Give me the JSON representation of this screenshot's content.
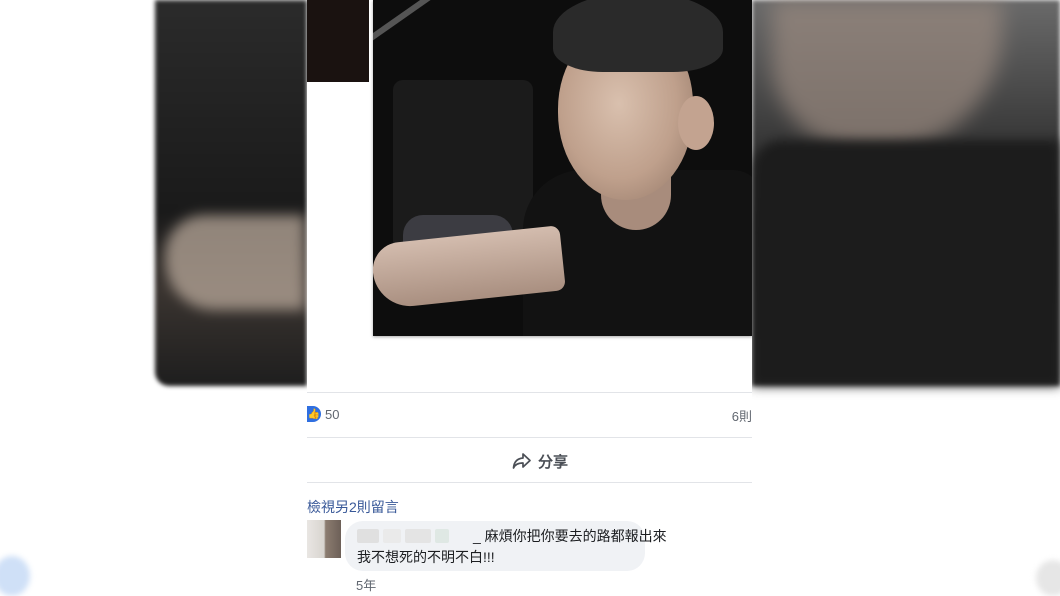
{
  "post": {
    "like_count": "50",
    "comments_count": "6則",
    "share_label": "分享",
    "view_more_comments": "檢視另2則留言"
  },
  "comment": {
    "line1": "_ 麻煩你把你要去的路都報出來",
    "line2": "我不想死的不明不白!!!",
    "time": "5年"
  },
  "icons": {
    "like": "like-icon",
    "share": "share-arrow-icon"
  },
  "colors": {
    "like_blue": "#2f6fe0",
    "link_blue": "#385898",
    "bubble_bg": "#f0f2f5"
  }
}
